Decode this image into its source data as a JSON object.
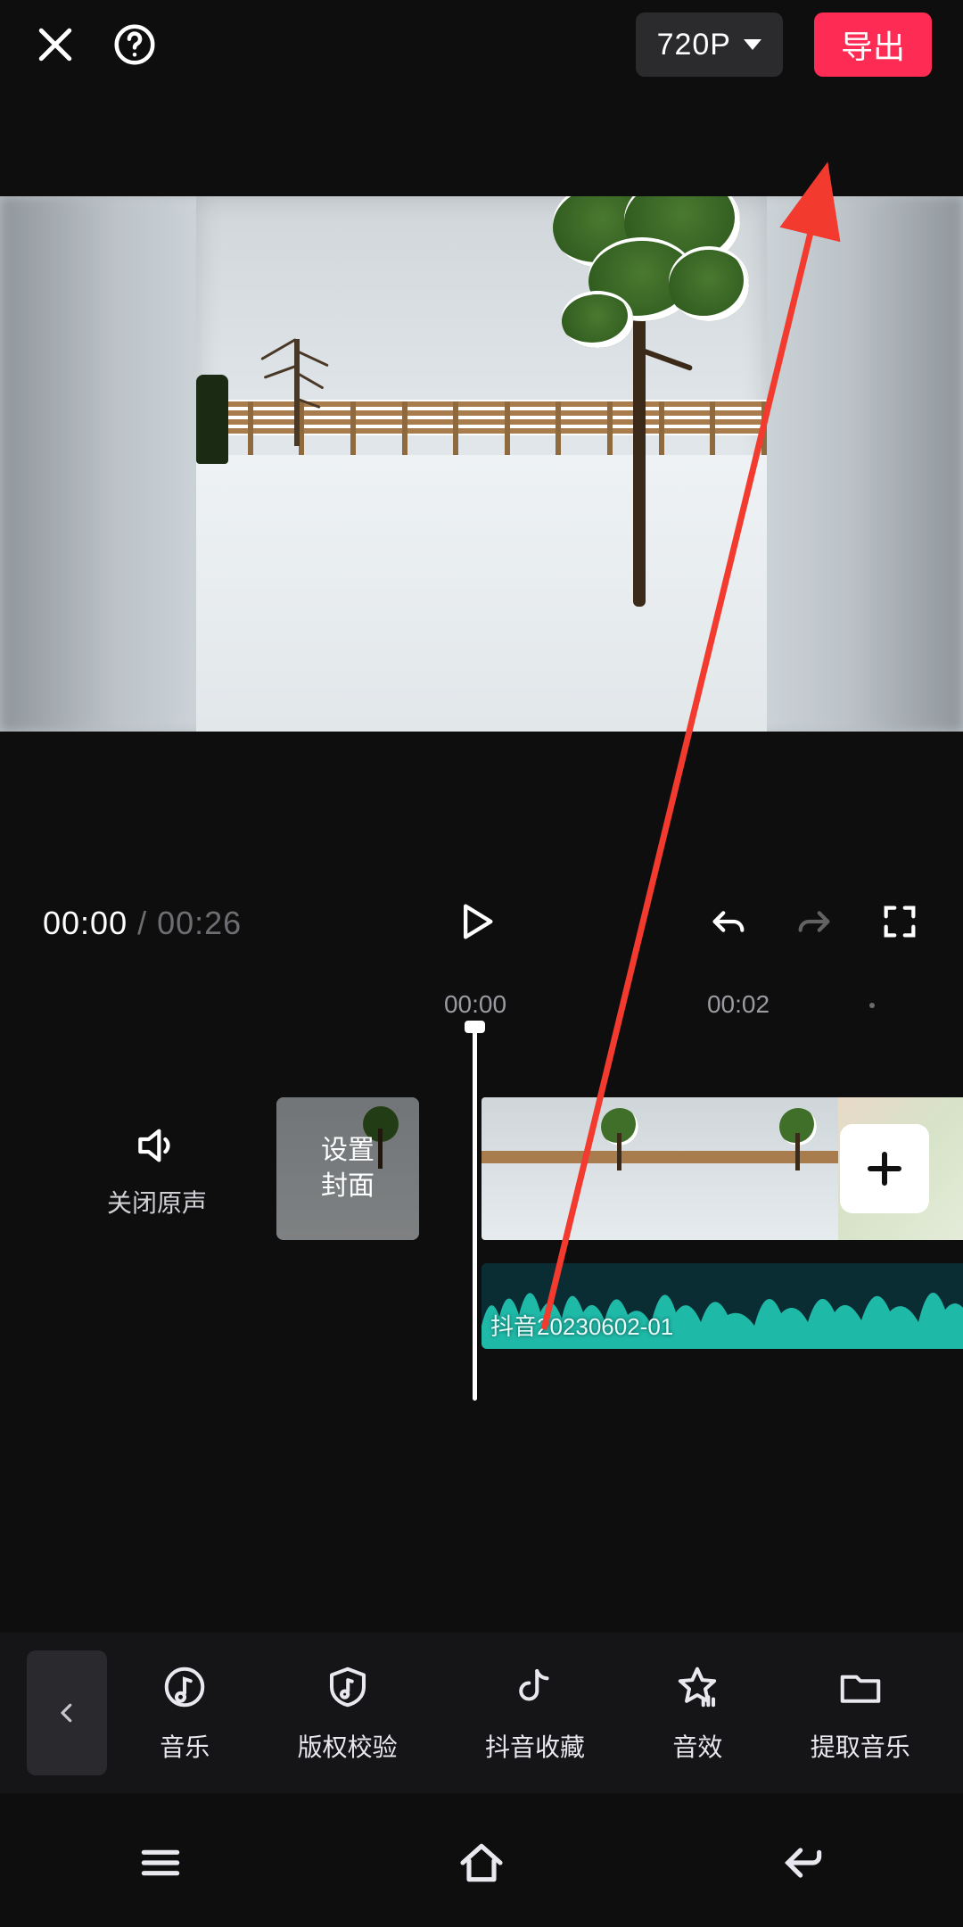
{
  "topbar": {
    "resolution": "720P",
    "export_label": "导出"
  },
  "playback": {
    "current": "00:00",
    "total": "00:26"
  },
  "ruler": {
    "marks": [
      "00:00",
      "00:02"
    ]
  },
  "timeline": {
    "mute_label": "关闭原声",
    "cover_label": "设置\n封面",
    "audio_clip_name": "抖音20230602-01"
  },
  "toolbar": {
    "items": [
      {
        "id": "music",
        "label": "音乐"
      },
      {
        "id": "verify",
        "label": "版权校验"
      },
      {
        "id": "douyin",
        "label": "抖音收藏"
      },
      {
        "id": "sfx",
        "label": "音效"
      },
      {
        "id": "extract",
        "label": "提取音乐"
      }
    ]
  },
  "colors": {
    "accent": "#fe2c55",
    "annotation": "#f23a2f",
    "waveform": "#1fb9a8"
  }
}
